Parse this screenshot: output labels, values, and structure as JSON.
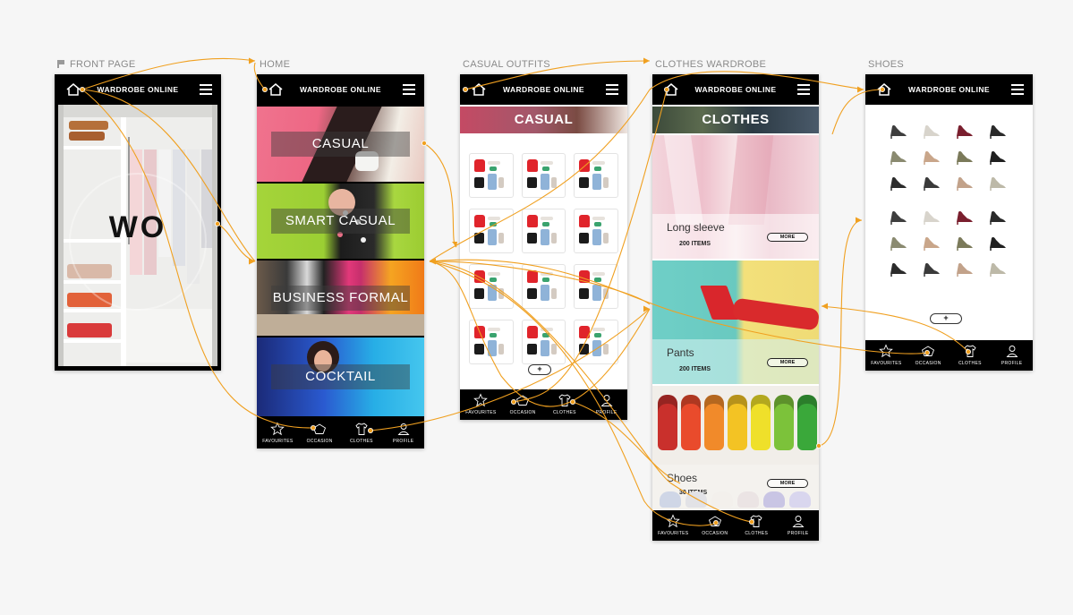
{
  "labels": {
    "front": "FRONT PAGE",
    "home": "HOME",
    "casual": "CASUAL OUTFITS",
    "clothes": "CLOTHES WARDROBE",
    "shoes": "SHOES"
  },
  "app": {
    "title": "WARDROBE ONLINE",
    "logo": "WO",
    "tabs": [
      "FAVOURITES",
      "OCCASION",
      "CLOTHES",
      "PROFILE"
    ]
  },
  "home": {
    "categories": [
      "CASUAL",
      "SMART CASUAL",
      "BUSINESS FORMAL",
      "COCKTAIL"
    ]
  },
  "casual": {
    "banner": "CASUAL",
    "add_label": "+"
  },
  "clothes": {
    "banner": "CLOTHES",
    "sections": [
      {
        "name": "Long sleeve",
        "count": "200 ITEMS",
        "more": "MORE"
      },
      {
        "name": "Pants",
        "count": "200 ITEMS",
        "more": "MORE"
      },
      {
        "name": "Shoes",
        "count": "30 ITEMS",
        "more": "MORE"
      }
    ]
  },
  "shoes": {
    "add_label": "+"
  },
  "colors": {
    "link": "#f0a020",
    "bar": "#000000"
  }
}
